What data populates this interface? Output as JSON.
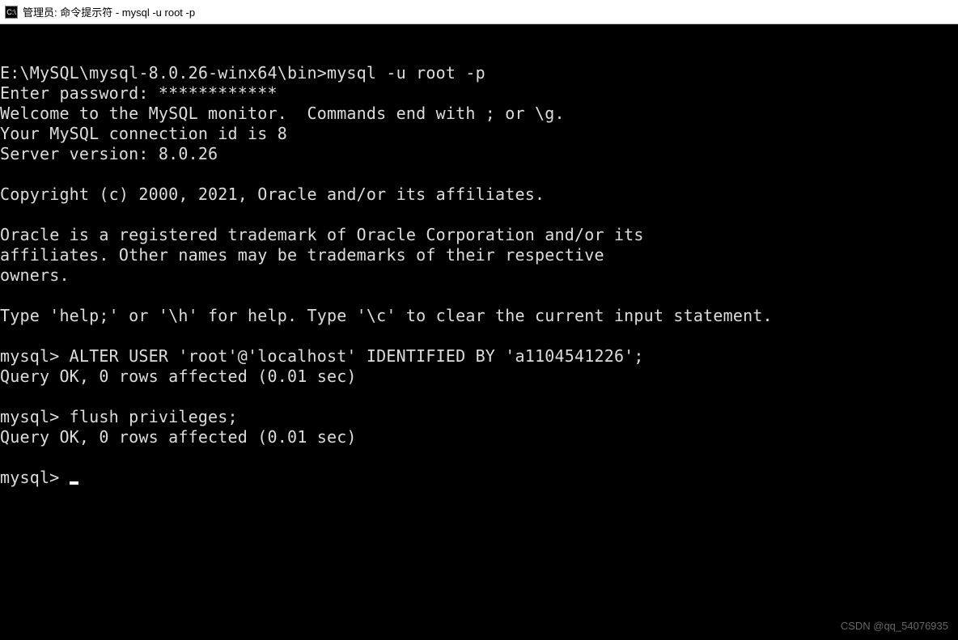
{
  "window": {
    "icon_label": "C:\\",
    "title": "管理员: 命令提示符 - mysql  -u root -p"
  },
  "terminal": {
    "lines": [
      "E:\\MySQL\\mysql-8.0.26-winx64\\bin>mysql -u root -p",
      "Enter password: ************",
      "Welcome to the MySQL monitor.  Commands end with ; or \\g.",
      "Your MySQL connection id is 8",
      "Server version: 8.0.26",
      "",
      "Copyright (c) 2000, 2021, Oracle and/or its affiliates.",
      "",
      "Oracle is a registered trademark of Oracle Corporation and/or its",
      "affiliates. Other names may be trademarks of their respective",
      "owners.",
      "",
      "Type 'help;' or '\\h' for help. Type '\\c' to clear the current input statement.",
      "",
      "mysql> ALTER USER 'root'@'localhost' IDENTIFIED BY 'a1104541226';",
      "Query OK, 0 rows affected (0.01 sec)",
      "",
      "mysql> flush privileges;",
      "Query OK, 0 rows affected (0.01 sec)",
      "",
      "mysql> "
    ]
  },
  "watermark": "CSDN @qq_54076935"
}
